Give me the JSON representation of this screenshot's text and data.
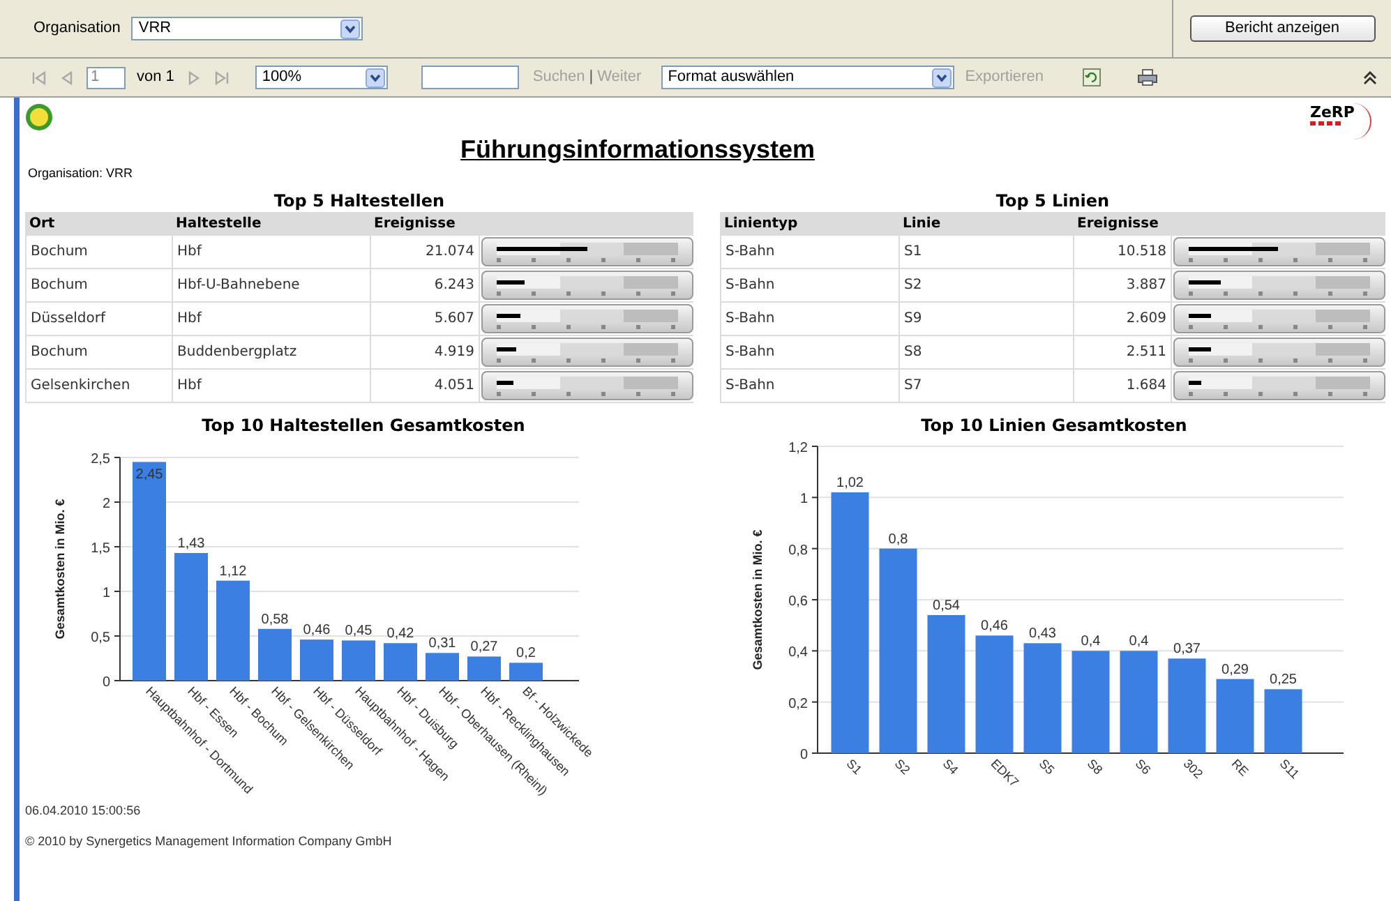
{
  "parameters": {
    "label": "Organisation",
    "value": "VRR"
  },
  "view_report_button": "Bericht anzeigen",
  "toolbar": {
    "nav_before": [
      {
        "kind": "first",
        "disabled": true
      },
      {
        "kind": "prev",
        "disabled": true
      }
    ],
    "page": "1",
    "page_of": "von 1",
    "nav_after": [
      {
        "kind": "next",
        "disabled": true
      },
      {
        "kind": "last",
        "disabled": true
      }
    ],
    "zoom": "100%",
    "search_links": [
      {
        "label": "Suchen",
        "disabled": true
      },
      {
        "label": "Weiter",
        "disabled": true
      }
    ],
    "separator": "|",
    "format": "Format auswählen",
    "export": {
      "label": "Exportieren",
      "disabled": true
    }
  },
  "report": {
    "logo_text": "ZeRP",
    "title": "Führungsinformationssystem",
    "organisation": "Organisation: VRR",
    "tables": [
      {
        "title": "Top 5 Haltestellen",
        "columns": [
          "Ort",
          "Haltestelle",
          "Ereignisse"
        ],
        "rows": [
          {
            "cells": [
              "Bochum",
              "Hbf",
              "21.074"
            ],
            "level": 0.5
          },
          {
            "cells": [
              "Bochum",
              "Hbf-U-Bahnebene",
              "6.243"
            ],
            "level": 0.15
          },
          {
            "cells": [
              "Düsseldorf",
              "Hbf",
              "5.607"
            ],
            "level": 0.13
          },
          {
            "cells": [
              "Bochum",
              "Buddenbergplatz",
              "4.919"
            ],
            "level": 0.11
          },
          {
            "cells": [
              "Gelsenkirchen",
              "Hbf",
              "4.051"
            ],
            "level": 0.09
          }
        ]
      },
      {
        "title": "Top 5 Linien",
        "columns": [
          "Linientyp",
          "Linie",
          "Ereignisse"
        ],
        "rows": [
          {
            "cells": [
              "S-Bahn",
              "S1",
              "10.518"
            ],
            "level": 0.49
          },
          {
            "cells": [
              "S-Bahn",
              "S2",
              "3.887"
            ],
            "level": 0.18
          },
          {
            "cells": [
              "S-Bahn",
              "S9",
              "2.609"
            ],
            "level": 0.12
          },
          {
            "cells": [
              "S-Bahn",
              "S8",
              "2.511"
            ],
            "level": 0.12
          },
          {
            "cells": [
              "S-Bahn",
              "S7",
              "1.684"
            ],
            "level": 0.07
          }
        ]
      }
    ],
    "charts": [
      {
        "title": "Top 10 Haltestellen Gesamtkosten",
        "chart_data": {
          "type": "bar",
          "grid": true,
          "ylabel": "Gesamtkosten in Mio. €",
          "categories": [
            "Hauptbahnhof - Dortmund",
            "Hbf - Essen",
            "Hbf - Bochum",
            "Hbf - Gelsenkirchen",
            "Hbf - Düsseldorf",
            "Hauptbahnhof - Hagen",
            "Hbf - Duisburg",
            "Hbf - Oberhausen (Rheinl)",
            "Hbf - Recklinghausen",
            "Bf - Holzwickede"
          ],
          "values": [
            2.45,
            1.43,
            1.12,
            0.58,
            0.46,
            0.45,
            0.42,
            0.31,
            0.27,
            0.2
          ],
          "value_labels": [
            "2,45",
            "1,43",
            "1,12",
            "0,58",
            "0,46",
            "0,45",
            "0,42",
            "0,31",
            "0,27",
            "0,2"
          ],
          "ylim": [
            0,
            2.5
          ],
          "yticks": [
            {
              "value": 0,
              "label": "0"
            },
            {
              "value": 0.5,
              "label": "0,5"
            },
            {
              "value": 1,
              "label": "1"
            },
            {
              "value": 1.5,
              "label": "1,5"
            },
            {
              "value": 2,
              "label": "2"
            },
            {
              "value": 2.5,
              "label": "2,5"
            }
          ]
        }
      },
      {
        "title": "Top 10 Linien Gesamtkosten",
        "chart_data": {
          "type": "bar",
          "grid": true,
          "ylabel": "Gesamtkosten in Mio. €",
          "categories": [
            "S1",
            "S2",
            "S4",
            "EDK7",
            "S5",
            "S8",
            "S6",
            "302",
            "RE",
            "S11"
          ],
          "values": [
            1.02,
            0.8,
            0.54,
            0.46,
            0.43,
            0.4,
            0.4,
            0.37,
            0.29,
            0.25
          ],
          "value_labels": [
            "1,02",
            "0,8",
            "0,54",
            "0,46",
            "0,43",
            "0,4",
            "0,4",
            "0,37",
            "0,29",
            "0,25"
          ],
          "ylim": [
            0,
            1.2
          ],
          "yticks": [
            {
              "value": 0,
              "label": "0"
            },
            {
              "value": 0.2,
              "label": "0,2"
            },
            {
              "value": 0.4,
              "label": "0,4"
            },
            {
              "value": 0.6,
              "label": "0,6"
            },
            {
              "value": 0.8,
              "label": "0,8"
            },
            {
              "value": 1,
              "label": "1"
            },
            {
              "value": 1.2,
              "label": "1,2"
            }
          ]
        }
      }
    ],
    "timestamp": "06.04.2010 15:00:56",
    "copyright": "© 2010 by Synergetics Management Information Company GmbH"
  }
}
